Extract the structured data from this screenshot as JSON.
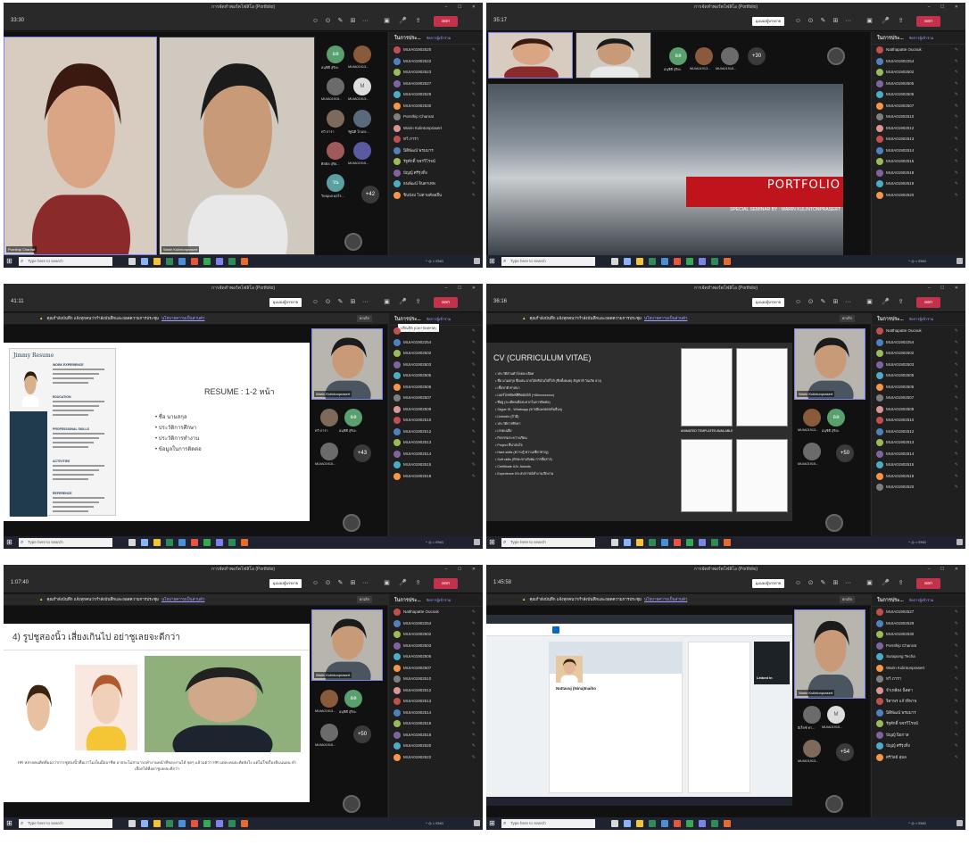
{
  "common": {
    "window_title": "การจัดทำพอร์ตโฟลิโอ (Portfolio)",
    "view_button": "มุมมองผู้บรรยาย",
    "leave_button": "ออก",
    "notice_text": "คุณกำลังบันทึก แจ้งทุกคนว่ากำลังบันทึกและถอดความการประชุม",
    "notice_link": "นโยบายความเป็นส่วนตัว",
    "notice_button": "ยกเลิก",
    "taskbar_search": "Type here to search",
    "tray_text": "^ ◎ ⌂ ENG",
    "panel_title": "ในการประ...",
    "panel_action": "จัดการผู้เข้าร่วม",
    "ctl_icons": [
      "☺",
      "⊙",
      "✎",
      "⊞",
      "···"
    ],
    "presenter_name": "Warin Kulintonprasert"
  },
  "frames": [
    {
      "time": "33:30",
      "participants": [
        "MUIA01902520",
        "MUIA01902522",
        "MUIA01902523",
        "MUIA01902527",
        "MUIA01902529",
        "MUIA01902530",
        "Pornthip Chanrat",
        "Warin Kulintonprasert",
        "ทวี ภารา",
        "นิติพัฒน์ พรมมาร",
        "รัฐศักดิ์ ขจรวิโรจน์",
        "ปัญญ์ ศรีรุ่งทิ่ง",
        "ธนพัฒน์ จินดาเทพ",
        "ชินบังม ไปตามค้ออยื่น"
      ],
      "tiles": [
        {
          "label": "อล",
          "color": "#5aa06e",
          "name": "อนุชิดี สุริยะ"
        },
        {
          "label": "",
          "color": "#8a5a3c",
          "name": "MUIA01913..."
        },
        {
          "label": "",
          "color": "#6b6b6b",
          "name": "MUIA01915..."
        },
        {
          "label": "M",
          "color": "#dddddd",
          "name": "MUIA01913..."
        },
        {
          "label": "",
          "color": "#7d6a5a",
          "name": "ทวี ภารา"
        },
        {
          "label": "",
          "color": "#5a6a7d",
          "name": "รัฐนิติ โกเถล..."
        },
        {
          "label": "",
          "color": "#a05a5a",
          "name": "ศิลพิล สุริย..."
        },
        {
          "label": "",
          "color": "#5a5aa0",
          "name": "MUIA01915..."
        },
        {
          "label": "วน",
          "color": "#5aa0a0",
          "name": "วิษณุพล ผลไร..."
        }
      ],
      "more": "+42",
      "host_name": "Pornthip Chanrat",
      "guest_name": "Warin Kulintonprasert"
    },
    {
      "time": "35:17",
      "participants": [
        "Natthapatte Oucsuk",
        "MUIA01902254",
        "MUIA01902502",
        "MUIA01902505",
        "MUIA01902506",
        "MUIA01902507",
        "MUIA01902510",
        "MUIA01902512",
        "MUIA01902513",
        "MUIA01902514",
        "MUIA01902515",
        "MUIA01902518",
        "MUIA01902519",
        "MUIA01902520"
      ],
      "panel_sub": "(บัญชี)",
      "tiles": [
        {
          "label": "อล",
          "color": "#5aa06e",
          "name": "อนุชิดี สุริยะ"
        },
        {
          "label": "",
          "color": "#8a5a3c",
          "name": "MUIA01913..."
        },
        {
          "label": "",
          "color": "#6b6b6b",
          "name": "MUIA01915..."
        }
      ],
      "more": "+30",
      "slide_title": "PORTFOLIO",
      "slide_subtitle": "SPECIAL SEMINAR  BY : WARIN KULINTONPRASERT"
    },
    {
      "time": "41:11",
      "participants": [
        "Natthapatte Oucsuk",
        "MUIA01902254",
        "MUIA01902502",
        "MUIA01902503",
        "MUIA01902505",
        "MUIA01902506",
        "MUIA01902507",
        "MUIA01902509",
        "MUIA01902510",
        "MUIA01902512",
        "MUIA01902513",
        "MUIA01902514",
        "MUIA01902515",
        "MUIA01902518"
      ],
      "panel_tooltip": "ปกิณกิต (Ctrl+Shift+M)",
      "tiles": [
        {
          "label": "",
          "color": "#7d6a5a",
          "name": "ทวี ภารา"
        },
        {
          "label": "อล",
          "color": "#5aa06e",
          "name": "อนุชิดี สุริยะ"
        },
        {
          "label": "",
          "color": "#6b6b6b",
          "name": "MUIA01915..."
        }
      ],
      "more": "+43",
      "slide_heading": "RESUME : 1-2 หน้า",
      "bullets": [
        "ชื่อ นามสกุล",
        "ประวัติการศึกษา",
        "ประวัติการทำงาน",
        "ข้อมูลในการติดต่อ"
      ],
      "resume_name": "Jimmy Resume",
      "resume_sections": [
        "WORK EXPERIENCE",
        "EDUCATION",
        "PROFESSIONAL SKILLS",
        "ACTIVITIES",
        "REFERENCE"
      ]
    },
    {
      "time": "36:16",
      "participants": [
        "Natthapatte Oucsuk",
        "MUIA01902254",
        "MUIA01902502",
        "MUIA01902503",
        "MUIA01902505",
        "MUIA01902506",
        "MUIA01902507",
        "MUIA01902509",
        "MUIA01902510",
        "MUIA01902512",
        "MUIA01902513",
        "MUIA01902514",
        "MUIA01902515",
        "MUIA01902518",
        "MUIA01902520"
      ],
      "tiles": [
        {
          "label": "",
          "color": "#8a5a3c",
          "name": "MUIA01913..."
        },
        {
          "label": "อล",
          "color": "#5aa06e",
          "name": "อนุชิดี สุริยะ"
        },
        {
          "label": "",
          "color": "#6b6b6b",
          "name": "MUIA01915..."
        }
      ],
      "more": "+50",
      "slide_heading": "CV (CURRICULUM VITAE)",
      "bullets": [
        "ประวัติส่วนตัวโดยละเอียด",
        "ชื่อ นามสกุล ชื่อเล่น อาจใส่หรือไม่ใส่ก็ได้ (ชื่อทั้งหมด) สัญชาติ วันเกิด อายุ",
        "เชื้อชาติ ศาสนา",
        "เบอร์โทรศัพท์ที่ติดต่อได้ (+66xxxxxxxxx)",
        "ที่อยู่ (ละเอียดเพื่อสะดวกในการติดต่อ)",
        "Skype ID , Whatsapp (หากมีแพลตฟอร์มอื่นๆ)",
        "LinkedIn (ถ้ามี)",
        "ประวัติการศึกษา",
        "เกรดเฉลี่ย",
        "กิจกรรมระหว่างเรียน",
        "Project ที่น่าสนใจ",
        "Hard skills (ความรู้ ความเชี่ยวชาญ)",
        "Soft skills (ทักษะทางสังคม การสื่อสาร)",
        "Certificate และ Awards",
        "Experience ประสบการณ์ทำงาน ฝึกงาน"
      ],
      "templates_label": "ANIMATED TEMPLATES AVAILABLE"
    },
    {
      "time": "1:07:40",
      "participants": [
        "Natthapatte Oucsuk",
        "MUIA01902254",
        "MUIA01902502",
        "MUIA01902503",
        "MUIA01902506",
        "MUIA01902507",
        "MUIA01902510",
        "MUIA01902512",
        "MUIA01902513",
        "MUIA01902514",
        "MUIA01902515",
        "MUIA01902518",
        "MUIA01902520",
        "MUIA01902522"
      ],
      "tiles": [
        {
          "label": "",
          "color": "#8a5a3c",
          "name": "MUIA01913..."
        },
        {
          "label": "อล",
          "color": "#5aa06e",
          "name": "อนุชิดี สุริยะ"
        },
        {
          "label": "",
          "color": "#6b6b6b",
          "name": "MUIA01915..."
        }
      ],
      "more": "+50",
      "slide_heading": "4) รูปชูสองนิ้ว เสี่ยงเกินไป อย่าชูเลยจะดีกว่า",
      "caption": "HR หลายคนคิดที่มองว่าการชูสองนิ้วคือเราไม่เป็นมืออาชีพ อาจจะไม่สามารถทำงานหน้าที่ของงานได้ จุดๆ แล้วแต่ว่า HR แต่ละคนจะคิดยังไง แต่ไม่ใช่เรื่องดีแน่นอน ทำเลือกได้ที่อย่าชูเลยจะดีกว่า"
    },
    {
      "time": "1:45:58",
      "participants": [
        "MUIA01902527",
        "MUIA01902529",
        "MUIA01902530",
        "Pornthip Chanrat",
        "Surapong Techa",
        "Warin Kulintonprasert",
        "ทวี ภารา",
        "จำเหลียง นิ่ดดา",
        "จิดาพร แก้วทิพาพ",
        "นิติพัฒน์ พรมมาร",
        "รัฐศักดิ์ ขจรวิโรจน์",
        "ปัญญ์ นิยกาส",
        "ปัญญ์ ศรีรุ่งทิ่ง",
        "ศรีวัลย์ สุมล"
      ],
      "tiles": [
        {
          "label": "",
          "color": "#6b6b6b",
          "name": "อิเร็กซ์ ทา..."
        },
        {
          "label": "M",
          "color": "#dddddd",
          "name": "MUIA01915..."
        },
        {
          "label": "",
          "color": "#7d6a5a",
          "name": "MUIA01913..."
        }
      ],
      "more": "+54",
      "profile_name": "Nattavuj (Nina)Inaiho",
      "linkedin_label": "Linked in"
    }
  ]
}
